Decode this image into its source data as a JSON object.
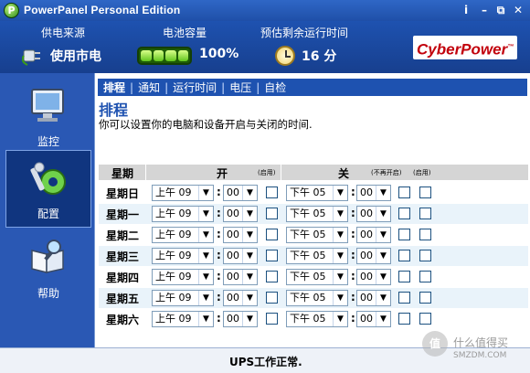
{
  "titlebar": {
    "app_title": "PowerPanel Personal Edition",
    "info": "i",
    "minimize": "–",
    "restore": "⧉",
    "close": "✕"
  },
  "header": {
    "power_source_label": "供电来源",
    "power_source_value": "使用市电",
    "battery_label": "电池容量",
    "battery_value": "100%",
    "battery_level": 1.0,
    "runtime_label": "预估剩余运行时间",
    "runtime_value": "16 分",
    "brand": "CyberPower",
    "brand_tm": "™"
  },
  "nav": [
    {
      "label": "监控",
      "icon": "monitor-icon",
      "active": false
    },
    {
      "label": "配置",
      "icon": "wrench-gear-icon",
      "active": true
    },
    {
      "label": "帮助",
      "icon": "book-magnifier-icon",
      "active": false
    }
  ],
  "tabs": [
    {
      "label": "排程",
      "active": true
    },
    {
      "label": "通知",
      "active": false
    },
    {
      "label": "运行时间",
      "active": false
    },
    {
      "label": "电压",
      "active": false
    },
    {
      "label": "自检",
      "active": false
    }
  ],
  "page": {
    "title": "排程",
    "description": "你可以设置你的电脑和设备开启与关闭的时间."
  },
  "table": {
    "col_day": "星期",
    "col_on": "开",
    "col_on_enable": "(启用)",
    "col_off": "关",
    "col_off_noreboot": "(不再开启)",
    "col_off_enable": "(启用)",
    "rows": [
      {
        "day": "星期日",
        "on_hour": "上午 09",
        "on_min": "00",
        "off_hour": "下午 05",
        "off_min": "00"
      },
      {
        "day": "星期一",
        "on_hour": "上午 09",
        "on_min": "00",
        "off_hour": "下午 05",
        "off_min": "00"
      },
      {
        "day": "星期二",
        "on_hour": "上午 09",
        "on_min": "00",
        "off_hour": "下午 05",
        "off_min": "00"
      },
      {
        "day": "星期三",
        "on_hour": "上午 09",
        "on_min": "00",
        "off_hour": "下午 05",
        "off_min": "00"
      },
      {
        "day": "星期四",
        "on_hour": "上午 09",
        "on_min": "00",
        "off_hour": "下午 05",
        "off_min": "00"
      },
      {
        "day": "星期五",
        "on_hour": "上午 09",
        "on_min": "00",
        "off_hour": "下午 05",
        "off_min": "00"
      },
      {
        "day": "星期六",
        "on_hour": "上午 09",
        "on_min": "00",
        "off_hour": "下午 05",
        "off_min": "00"
      }
    ]
  },
  "status": {
    "message": "UPS工作正常."
  },
  "watermark": {
    "badge": "值",
    "text": "什么值得买",
    "sub": "SMZDM.COM"
  }
}
